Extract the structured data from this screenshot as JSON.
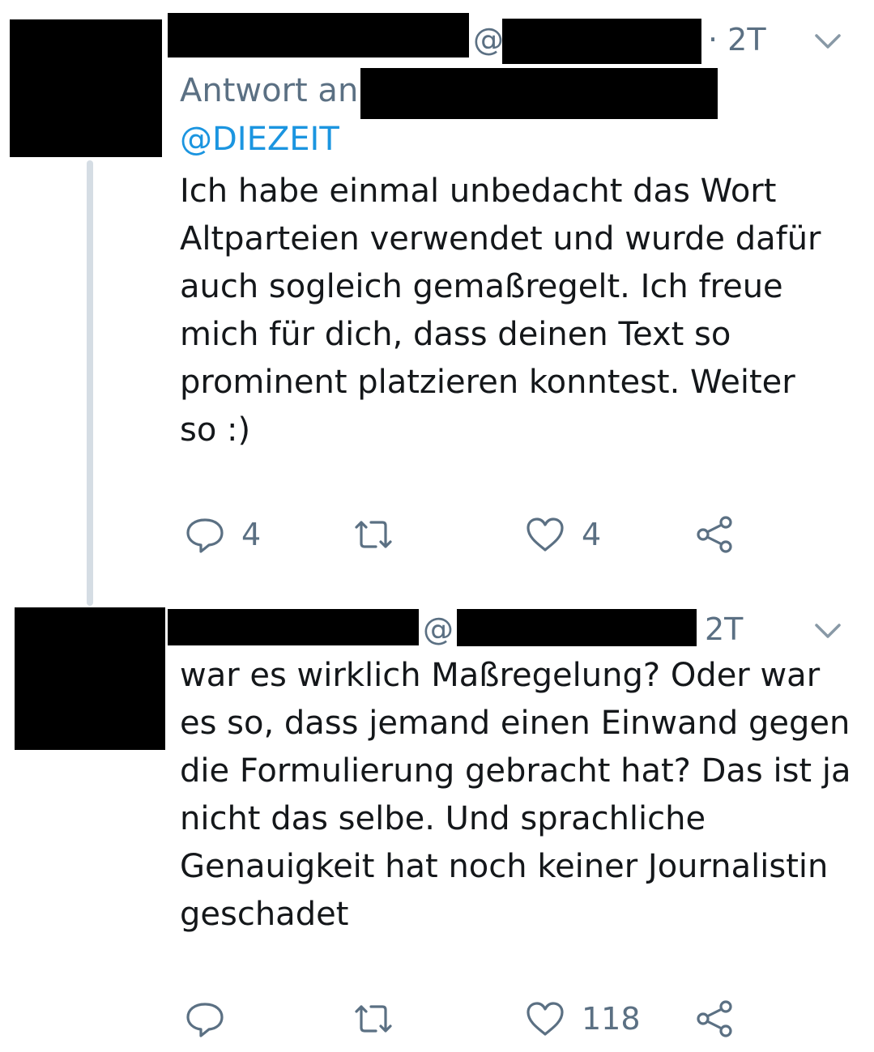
{
  "tweet1": {
    "handle_prefix": "@",
    "time": "· 2T",
    "reply_to_label": "Antwort an",
    "mention": "@DIEZEIT",
    "text_lines": [
      "Ich habe einmal unbedacht das Wort",
      "Altparteien verwendet und wurde dafür",
      "auch sogleich gemaßregelt. Ich freue",
      "mich für dich, dass deinen Text so",
      "prominent platzieren konntest. Weiter",
      "so :)"
    ],
    "actions": {
      "reply_count": "4",
      "retweet_count": "",
      "like_count": "4"
    }
  },
  "tweet2": {
    "handle_prefix": "@",
    "time": "2T",
    "text_lines": [
      "war es wirklich Maßregelung? Oder war",
      "es so, dass jemand einen Einwand gegen",
      "die Formulierung gebracht hat? Das ist ja",
      "nicht das selbe. Und sprachliche",
      "Genauigkeit hat noch keiner Journalistin",
      "geschadet"
    ],
    "actions": {
      "reply_count": "",
      "retweet_count": "",
      "like_count": "118"
    }
  },
  "colors": {
    "meta_gray": "#5b7083",
    "link_blue": "#1b95e0",
    "text": "#14171a",
    "thread_line": "#d5dde4"
  },
  "icons": [
    "reply-icon",
    "retweet-icon",
    "like-icon",
    "share-icon",
    "chevron-down-icon"
  ]
}
